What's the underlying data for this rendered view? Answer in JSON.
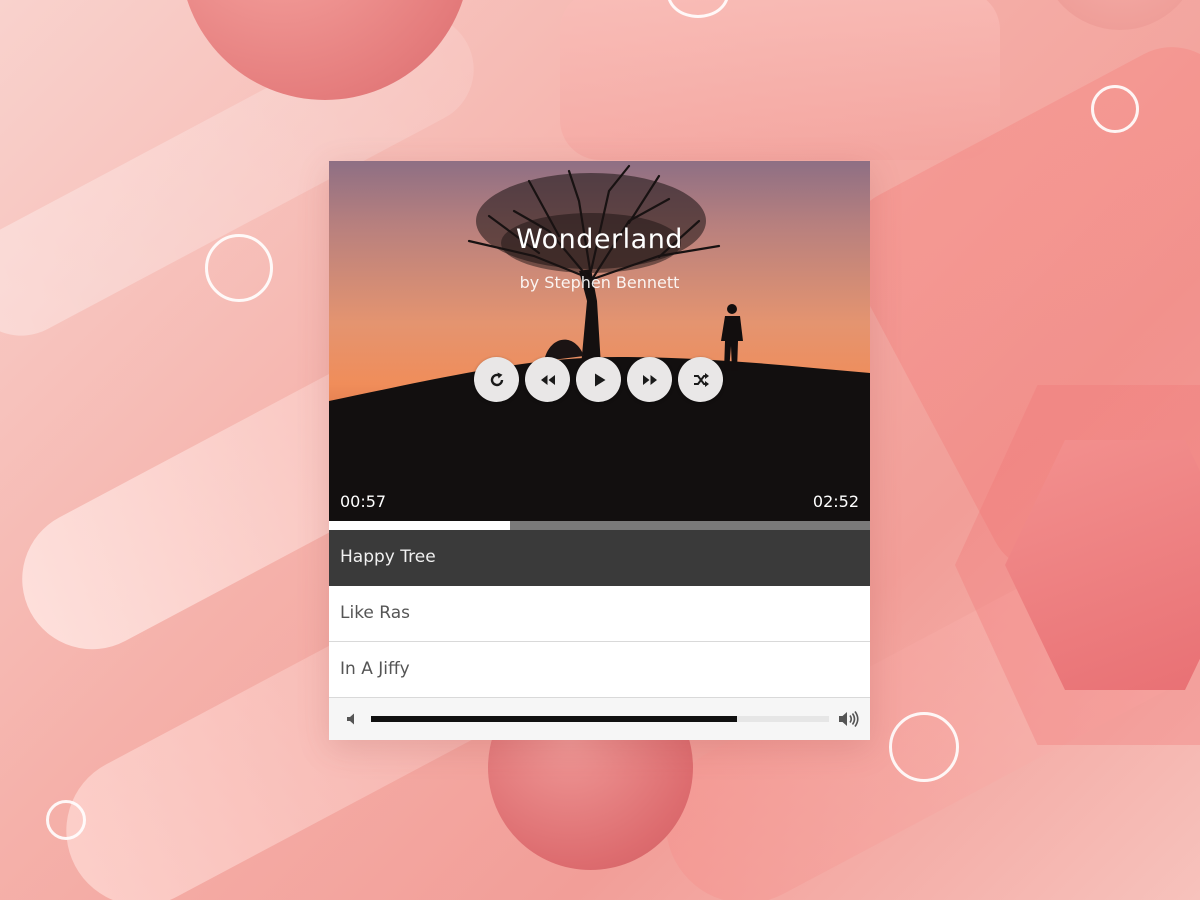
{
  "player": {
    "title": "Wonderland",
    "artist": "by Stephen Bennett",
    "current_time": "00:57",
    "total_time": "02:52",
    "progress_fraction": 0.335,
    "volume_fraction": 0.8
  },
  "controls": [
    {
      "name": "repeat-button",
      "icon": "repeat-icon"
    },
    {
      "name": "rewind-button",
      "icon": "rewind-icon"
    },
    {
      "name": "play-button",
      "icon": "play-icon"
    },
    {
      "name": "fast-forward-button",
      "icon": "fast-forward-icon"
    },
    {
      "name": "shuffle-button",
      "icon": "shuffle-icon"
    }
  ],
  "playlist": {
    "items": [
      {
        "label": "Happy Tree",
        "active": true
      },
      {
        "label": "Like Ras",
        "active": false
      },
      {
        "label": "In A Jiffy",
        "active": false
      }
    ]
  },
  "colors": {
    "active_row": "#3a3a3a",
    "progress_fill": "#ffffff",
    "progress_track": "#7a7a7a",
    "volume_fill": "#111111",
    "button_bg": "#e9e7e7"
  },
  "icons": {
    "volume_low": "volume-low-icon",
    "volume_high": "volume-high-icon"
  }
}
